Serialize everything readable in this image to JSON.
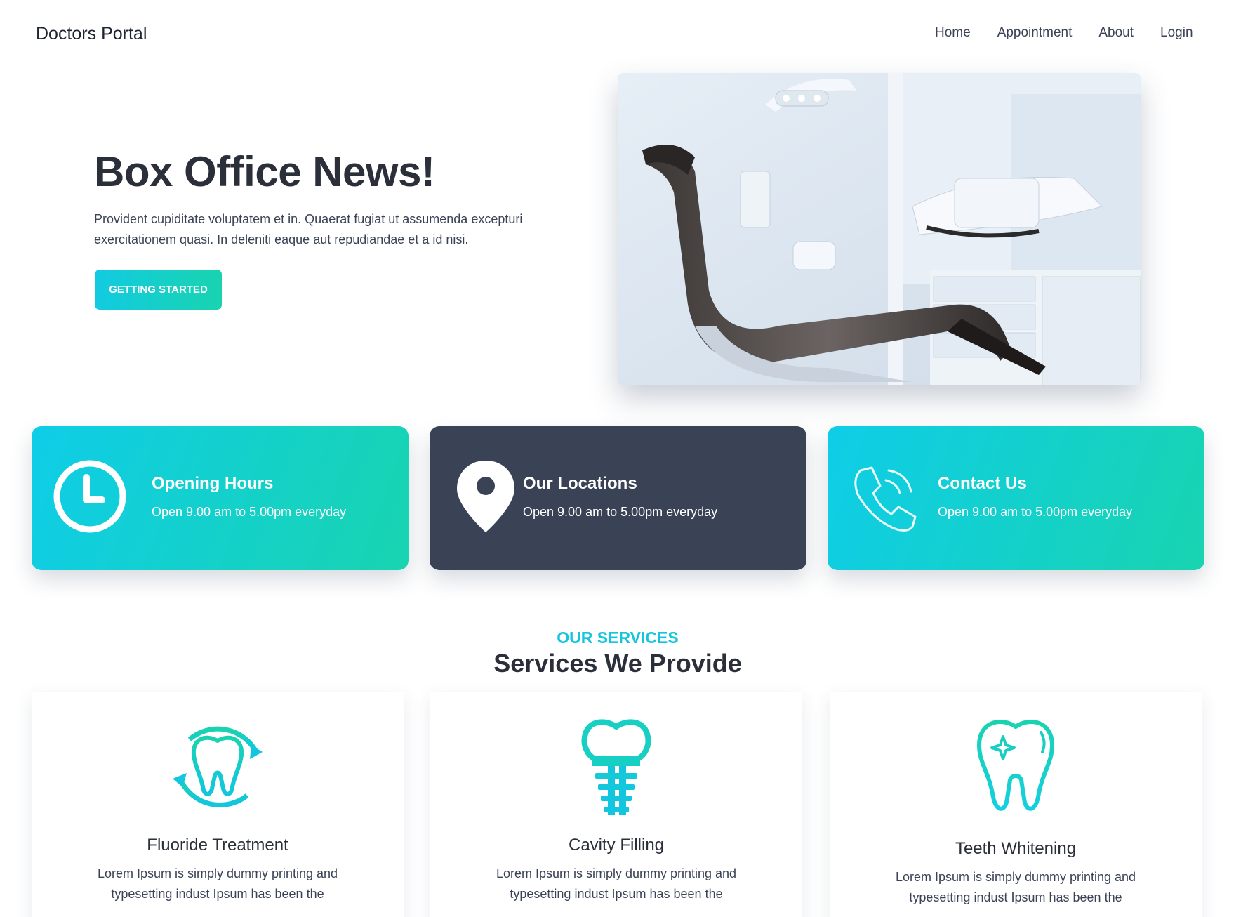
{
  "brand": "Doctors Portal",
  "nav": {
    "home": "Home",
    "appointment": "Appointment",
    "about": "About",
    "login": "Login"
  },
  "hero": {
    "title": "Box Office News!",
    "text": "Provident cupiditate voluptatem et in. Quaerat fugiat ut assumenda excepturi exercitationem quasi. In deleniti eaque aut repudiandae et a id nisi.",
    "button": "GETTING STARTED"
  },
  "info_cards": [
    {
      "title": "Opening Hours",
      "subtitle": "Open 9.00 am to 5.00pm everyday",
      "icon": "clock-icon"
    },
    {
      "title": "Our Locations",
      "subtitle": "Open 9.00 am to 5.00pm everyday",
      "icon": "location-pin-icon"
    },
    {
      "title": "Contact Us",
      "subtitle": "Open 9.00 am to 5.00pm everyday",
      "icon": "phone-icon"
    }
  ],
  "services": {
    "eyebrow": "OUR SERVICES",
    "title": "Services We Provide",
    "items": [
      {
        "title": "Fluoride Treatment",
        "text": "Lorem Ipsum is simply dummy printing and typesetting indust Ipsum has been the",
        "icon": "fluoride-tooth-icon"
      },
      {
        "title": "Cavity Filling",
        "text": "Lorem Ipsum is simply dummy printing and typesetting indust Ipsum has been the",
        "icon": "implant-icon"
      },
      {
        "title": "Teeth Whitening",
        "text": "Lorem Ipsum is simply dummy printing and typesetting indust Ipsum has been the",
        "icon": "sparkle-tooth-icon"
      }
    ]
  },
  "colors": {
    "accent": "#15c5de",
    "accent2": "#19d3b0",
    "dark": "#3a4256"
  }
}
